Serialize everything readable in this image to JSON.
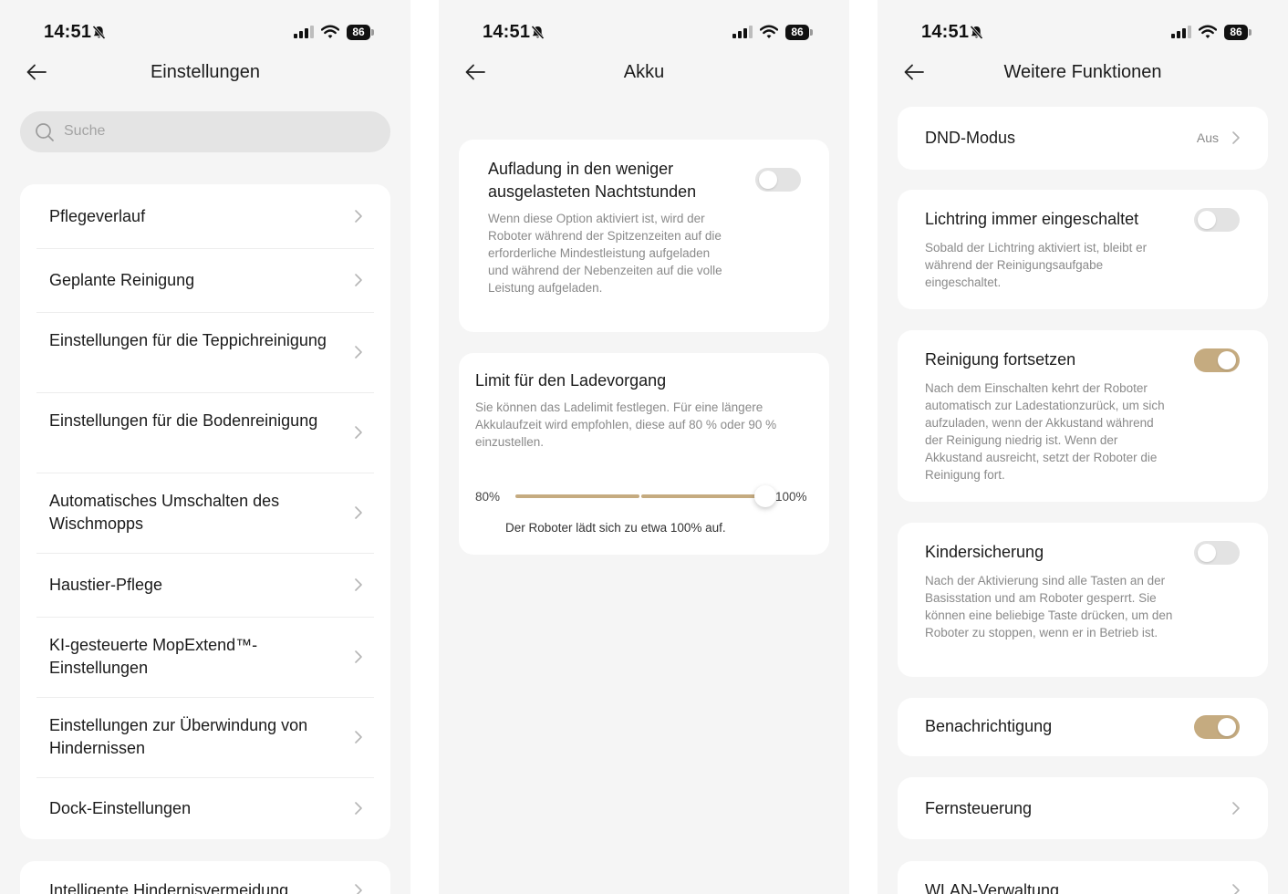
{
  "status": {
    "time": "14:51",
    "battery": "86"
  },
  "colors": {
    "accent": "#c5ab80",
    "toggle_off": "#e3e3e3",
    "background": "#f5f5f5"
  },
  "screen1": {
    "title": "Einstellungen",
    "search_placeholder": "Suche",
    "items": [
      {
        "label": "Pflegeverlauf"
      },
      {
        "label": "Geplante Reinigung"
      },
      {
        "label": "Einstellungen für die Teppichreinigung"
      },
      {
        "label": "Einstellungen für die Bodenreinigung"
      },
      {
        "label": "Automatisches Umschalten des Wischmopps"
      },
      {
        "label": "Haustier-Pflege"
      },
      {
        "label": "KI-gesteuerte MopExtend™-Einstellungen"
      },
      {
        "label": "Einstellungen zur Überwindung von Hindernissen"
      },
      {
        "label": "Dock-Einstellungen"
      }
    ],
    "peek_item": "Intelligente Hindernisvermeidung"
  },
  "screen2": {
    "title": "Akku",
    "offpeak": {
      "title": "Aufladung in den weniger ausgelasteten Nachtstunden",
      "desc": "Wenn diese Option aktiviert ist, wird der Roboter während der Spitzenzeiten auf die erforderliche Mindestleistung aufgeladen und während der Nebenzeiten auf die volle Leistung aufgeladen.",
      "enabled": false
    },
    "limit": {
      "title": "Limit für den Ladevorgang",
      "desc": "Sie können das Ladelimit festlegen. Für eine längere Akkulaufzeit wird empfohlen, diese auf 80 % oder 90 % einzustellen.",
      "min_label": "80%",
      "max_label": "100%",
      "value": 100,
      "min": 80,
      "max": 100,
      "note": "Der Roboter lädt sich zu etwa 100% auf."
    }
  },
  "screen3": {
    "title": "Weitere Funktionen",
    "dnd": {
      "label": "DND-Modus",
      "value": "Aus"
    },
    "light_ring": {
      "title": "Lichtring immer eingeschaltet",
      "desc": "Sobald der Lichtring aktiviert ist, bleibt er während der Reinigungsaufgabe eingeschaltet.",
      "enabled": false
    },
    "resume": {
      "title": "Reinigung fortsetzen",
      "desc": "Nach dem Einschalten kehrt der Roboter automatisch zur Ladestationzurück, um sich aufzuladen, wenn der Akkustand während der Reinigung niedrig ist. Wenn der Akkustand ausreicht, setzt der Roboter die Reinigung fort.",
      "enabled": true
    },
    "child_lock": {
      "title": "Kindersicherung",
      "desc": "Nach der Aktivierung sind alle Tasten an der Basisstation und am Roboter gesperrt. Sie können eine beliebige Taste drücken, um den Roboter zu stoppen, wenn er in Betrieb ist.",
      "enabled": false
    },
    "notification": {
      "label": "Benachrichtigung",
      "enabled": true
    },
    "remote": {
      "label": "Fernsteuerung"
    },
    "peek_item": "WLAN-Verwaltung"
  }
}
